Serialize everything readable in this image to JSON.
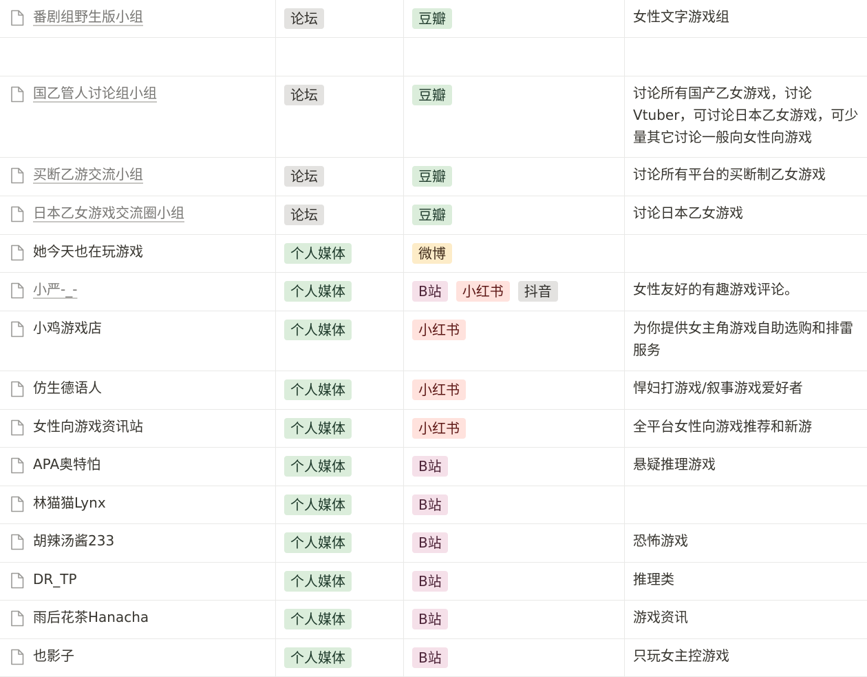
{
  "colors": {
    "论坛": {
      "bg": "#e3e2e0",
      "fg": "#32302c"
    },
    "个人媒体": {
      "bg": "#dbeddb",
      "fg": "#1c3829"
    },
    "豆瓣": {
      "bg": "#dbeddb",
      "fg": "#1c3829"
    },
    "微博": {
      "bg": "#fdecc8",
      "fg": "#402c1b"
    },
    "B站": {
      "bg": "#f5e0e9",
      "fg": "#4c2337"
    },
    "小红书": {
      "bg": "#ffe2dd",
      "fg": "#5d1715"
    },
    "抖音": {
      "bg": "#e3e2e0",
      "fg": "#32302c"
    }
  },
  "rows": [
    {
      "name": "番剧组野生版小组",
      "link": true,
      "type": "论坛",
      "platforms": [
        "豆瓣"
      ],
      "desc": "女性文字游戏组"
    },
    {
      "name": "",
      "link": false,
      "type": "",
      "platforms": [],
      "desc": ""
    },
    {
      "name": "国乙管人讨论组小组",
      "link": true,
      "type": "论坛",
      "platforms": [
        "豆瓣"
      ],
      "desc": "讨论所有国产乙女游戏，讨论Vtuber，可讨论日本乙女游戏，可少量其它讨论一般向女性向游戏"
    },
    {
      "name": "买断乙游交流小组",
      "link": true,
      "type": "论坛",
      "platforms": [
        "豆瓣"
      ],
      "desc": "讨论所有平台的买断制乙女游戏"
    },
    {
      "name": "日本乙女游戏交流圈小组",
      "link": true,
      "type": "论坛",
      "platforms": [
        "豆瓣"
      ],
      "desc": "讨论日本乙女游戏"
    },
    {
      "name": "她今天也在玩游戏",
      "link": false,
      "type": "个人媒体",
      "platforms": [
        "微博"
      ],
      "desc": ""
    },
    {
      "name": "小严-_-",
      "link": true,
      "type": "个人媒体",
      "platforms": [
        "B站",
        "小红书",
        "抖音"
      ],
      "desc": "女性友好的有趣游戏评论。"
    },
    {
      "name": "小鸡游戏店",
      "link": false,
      "type": "个人媒体",
      "platforms": [
        "小红书"
      ],
      "desc": "为你提供女主角游戏自助选购和排雷服务"
    },
    {
      "name": "仿生德语人",
      "link": false,
      "type": "个人媒体",
      "platforms": [
        "小红书"
      ],
      "desc": "悍妇打游戏/叙事游戏爱好者"
    },
    {
      "name": "女性向游戏资讯站",
      "link": false,
      "type": "个人媒体",
      "platforms": [
        "小红书"
      ],
      "desc": "全平台女性向游戏推荐和新游"
    },
    {
      "name": "APA奥特怕",
      "link": false,
      "type": "个人媒体",
      "platforms": [
        "B站"
      ],
      "desc": "悬疑推理游戏"
    },
    {
      "name": "林猫猫Lynx",
      "link": false,
      "type": "个人媒体",
      "platforms": [
        "B站"
      ],
      "desc": ""
    },
    {
      "name": "胡辣汤酱233",
      "link": false,
      "type": "个人媒体",
      "platforms": [
        "B站"
      ],
      "desc": "恐怖游戏"
    },
    {
      "name": "DR_TP",
      "link": false,
      "type": "个人媒体",
      "platforms": [
        "B站"
      ],
      "desc": "推理类"
    },
    {
      "name": "雨后花茶Hanacha",
      "link": false,
      "type": "个人媒体",
      "platforms": [
        "B站"
      ],
      "desc": "游戏资讯"
    },
    {
      "name": "也影子",
      "link": false,
      "type": "个人媒体",
      "platforms": [
        "B站"
      ],
      "desc": "只玩女主控游戏"
    }
  ]
}
